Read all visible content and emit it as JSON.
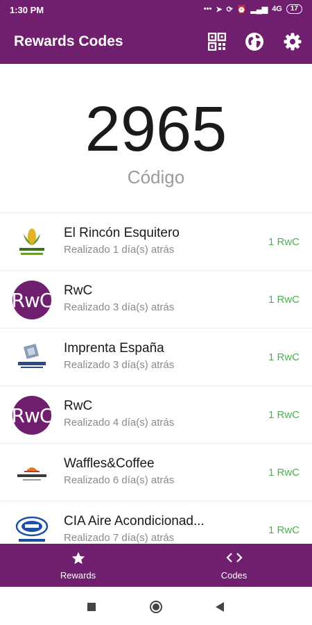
{
  "status_bar": {
    "time": "1:30 PM",
    "network": "4G",
    "battery": "17"
  },
  "app_bar": {
    "title": "Rewards Codes",
    "actions": [
      "qr-code-icon",
      "globe-icon",
      "settings-icon"
    ]
  },
  "code": {
    "value": "2965",
    "label": "Código"
  },
  "rewards": [
    {
      "name": "El Rincón Esquitero",
      "subtitle": "Realizado 1 día(s) atrás",
      "badge": "1 RwC",
      "logo": "corn-logo"
    },
    {
      "name": "RwC",
      "subtitle": "Realizado 3 día(s) atrás",
      "badge": "1 RwC",
      "logo": "RwC"
    },
    {
      "name": "Imprenta España",
      "subtitle": "Realizado 3 día(s) atrás",
      "badge": "1 RwC",
      "logo": "press-logo"
    },
    {
      "name": "RwC",
      "subtitle": "Realizado 4 día(s) atrás",
      "badge": "1 RwC",
      "logo": "RwC"
    },
    {
      "name": "Waffles&Coffee",
      "subtitle": "Realizado 6 día(s) atrás",
      "badge": "1 RwC",
      "logo": "waffles-logo"
    },
    {
      "name": "CIA Aire Acondicionad...",
      "subtitle": "Realizado 7 día(s) atrás",
      "badge": "1 RwC",
      "logo": "aircon-logo"
    }
  ],
  "bottom_nav": [
    {
      "label": "Rewards",
      "icon": "star-icon"
    },
    {
      "label": "Codes",
      "icon": "code-icon"
    }
  ],
  "colors": {
    "primary": "#701f6f",
    "accent_green": "#4caf50"
  }
}
